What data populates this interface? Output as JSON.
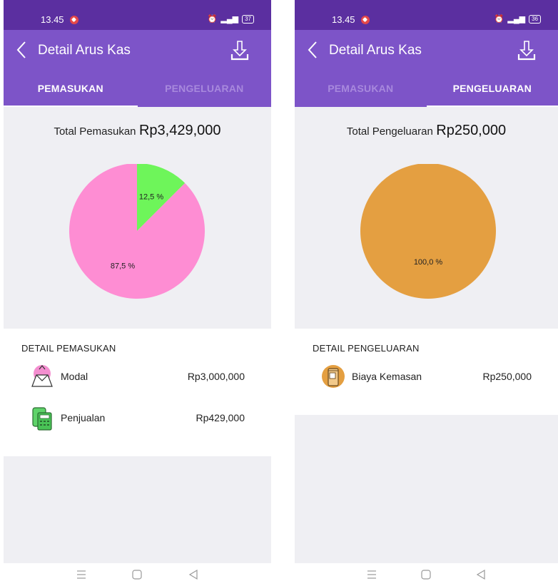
{
  "left": {
    "status": {
      "time": "13.45",
      "icons": "⏰ 📳 ⁴ᴳ ▮",
      "battery": "37"
    },
    "appbar": {
      "title": "Detail Arus Kas"
    },
    "tabs": [
      {
        "label": "PEMASUKAN",
        "active": true
      },
      {
        "label": "PENGELUARAN",
        "active": false
      }
    ],
    "total": {
      "label": "Total Pemasukan",
      "amount": "Rp3,429,000"
    },
    "chart_data": {
      "type": "pie",
      "slices": [
        {
          "label": "12,5 %",
          "value": 12.5,
          "color": "#6ef55a"
        },
        {
          "label": "87,5 %",
          "value": 87.5,
          "color": "#fe8dd3"
        }
      ]
    },
    "detail": {
      "header": "DETAIL PEMASUKAN",
      "items": [
        {
          "label": "Modal",
          "amount": "Rp3,000,000",
          "icon": "money-bag-icon"
        },
        {
          "label": "Penjualan",
          "amount": "Rp429,000",
          "icon": "cash-register-icon"
        }
      ]
    }
  },
  "right": {
    "status": {
      "time": "13.45",
      "icons": "⏰ 📳 ⁴ᴳ ▮",
      "battery": "36"
    },
    "appbar": {
      "title": "Detail Arus Kas"
    },
    "tabs": [
      {
        "label": "PEMASUKAN",
        "active": false
      },
      {
        "label": "PENGELUARAN",
        "active": true
      }
    ],
    "total": {
      "label": "Total Pengeluaran",
      "amount": "Rp250,000"
    },
    "chart_data": {
      "type": "pie",
      "slices": [
        {
          "label": "100,0 %",
          "value": 100.0,
          "color": "#e49f41"
        }
      ]
    },
    "detail": {
      "header": "DETAIL PENGELUARAN",
      "items": [
        {
          "label": "Biaya Kemasan",
          "amount": "Rp250,000",
          "icon": "package-box-icon"
        }
      ]
    }
  },
  "colors": {
    "statusbar": "#5b2fa0",
    "appbar": "#7d54c8",
    "tab_inactive": "#a889dd",
    "background": "#efeff3"
  }
}
